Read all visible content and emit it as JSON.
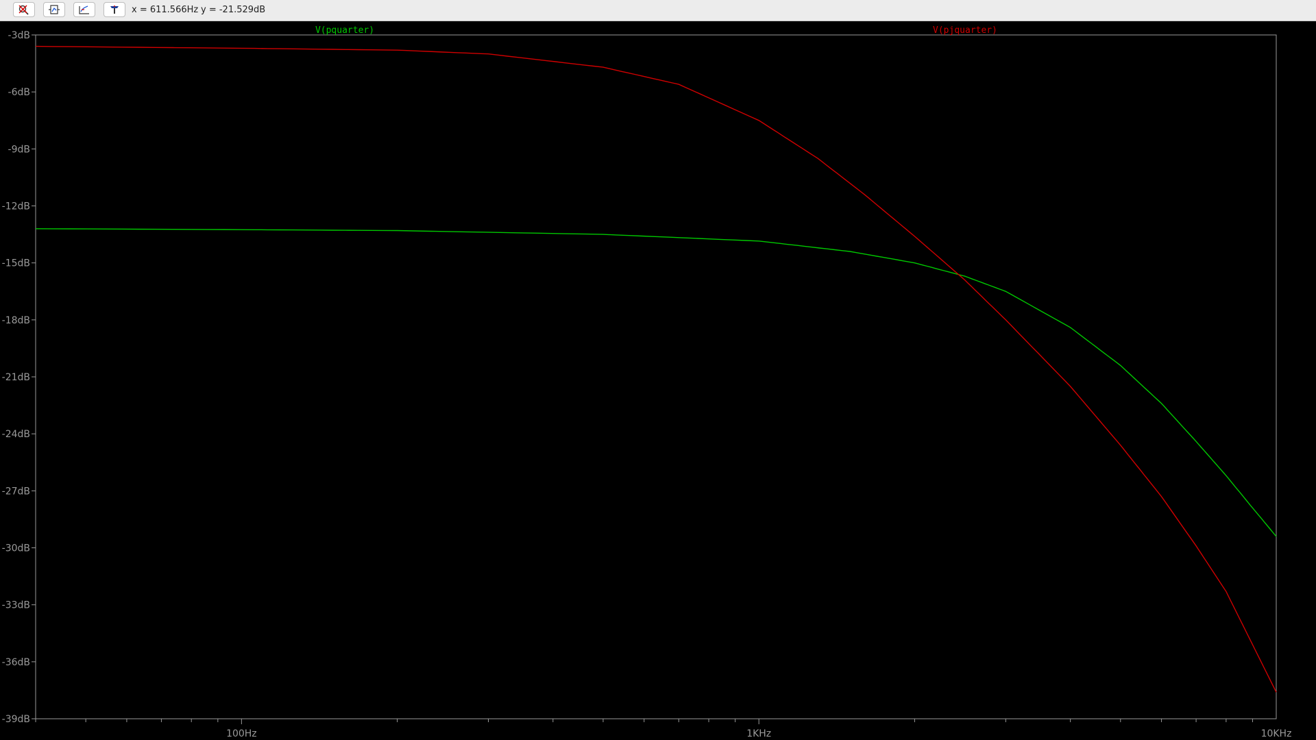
{
  "toolbar": {
    "buttons": [
      {
        "name": "zoom-cancel-button",
        "icon": "magnifier-cross-icon"
      },
      {
        "name": "zoom-extents-button",
        "icon": "zoom-extents-icon"
      },
      {
        "name": "pan-button",
        "icon": "pan-icon"
      },
      {
        "name": "probe-button",
        "icon": "probe-icon"
      }
    ],
    "cursor_x": "x = 611.566Hz",
    "cursor_y": "y = -21.529dB"
  },
  "colors": {
    "background": "#000000",
    "axis": "#9a9a9a",
    "series_green": "#00c800",
    "series_red": "#d00000"
  },
  "chart_data": {
    "type": "line",
    "title": "",
    "xlabel": "",
    "ylabel": "",
    "x_scale": "log",
    "xlim": [
      40,
      10000
    ],
    "ylim": [
      -39,
      -3
    ],
    "grid": false,
    "y_ticks": [
      -3,
      -6,
      -9,
      -12,
      -15,
      -18,
      -21,
      -24,
      -27,
      -30,
      -33,
      -36,
      -39
    ],
    "y_tick_labels": [
      "-3dB",
      "-6dB",
      "-9dB",
      "-12dB",
      "-15dB",
      "-18dB",
      "-21dB",
      "-24dB",
      "-27dB",
      "-30dB",
      "-33dB",
      "-36dB",
      "-39dB"
    ],
    "x_major_ticks": [
      100,
      1000,
      10000
    ],
    "x_tick_labels": [
      "100Hz",
      "1KHz",
      "10KHz"
    ],
    "series": [
      {
        "name": "V(pquarter)",
        "color": "#00c800",
        "label_position": "top-left",
        "x": [
          40,
          100,
          200,
          500,
          1000,
          1500,
          2000,
          2500,
          3000,
          4000,
          5000,
          6000,
          7000,
          8000,
          9000,
          10000
        ],
        "y": [
          -13.2,
          -13.25,
          -13.3,
          -13.5,
          -13.85,
          -14.4,
          -15.0,
          -15.7,
          -16.5,
          -18.4,
          -20.4,
          -22.4,
          -24.4,
          -26.2,
          -27.9,
          -29.4
        ]
      },
      {
        "name": "V(pjquarter)",
        "color": "#d00000",
        "label_position": "top-right",
        "x": [
          40,
          100,
          200,
          300,
          500,
          700,
          1000,
          1300,
          1600,
          2000,
          2500,
          3000,
          4000,
          5000,
          6000,
          7000,
          8000,
          10000
        ],
        "y": [
          -3.6,
          -3.7,
          -3.8,
          -4.0,
          -4.7,
          -5.6,
          -7.5,
          -9.5,
          -11.4,
          -13.6,
          -15.9,
          -18.0,
          -21.5,
          -24.6,
          -27.3,
          -29.9,
          -32.3,
          -37.6
        ]
      }
    ]
  }
}
